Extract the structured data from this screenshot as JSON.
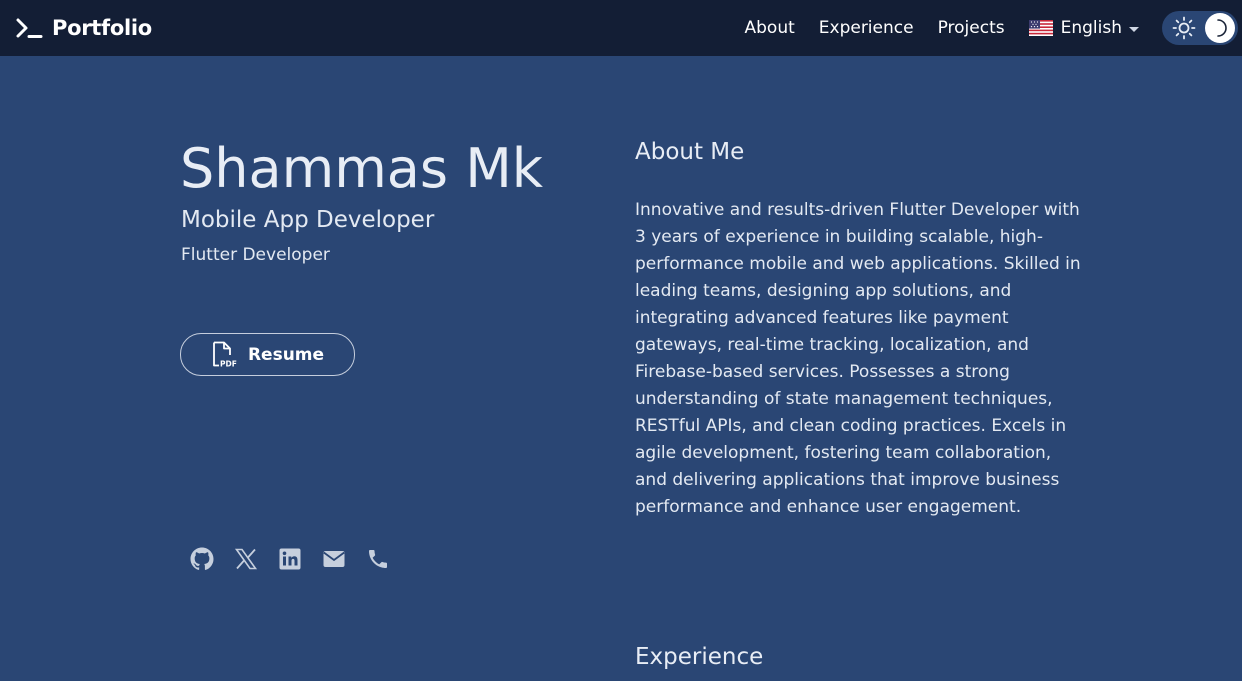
{
  "navbar": {
    "brand": {
      "icon": "terminal-icon",
      "label": "Portfolio"
    },
    "links": [
      {
        "label": "About"
      },
      {
        "label": "Experience"
      },
      {
        "label": "Projects"
      }
    ],
    "language": {
      "icon": "us-flag-icon",
      "label": "English"
    },
    "theme_toggle": {
      "icons": [
        "sun-icon",
        "moon-icon"
      ],
      "mode": "dark"
    }
  },
  "hero": {
    "name": "Shammas Mk",
    "role": "Mobile App Developer",
    "subtitle": "Flutter Developer",
    "resume_button": {
      "icon": "pdf-file-icon",
      "label": "Resume"
    },
    "socials": [
      "github-icon",
      "x-icon",
      "linkedin-icon",
      "mail-icon",
      "phone-icon"
    ]
  },
  "about": {
    "title": "About Me",
    "text": "Innovative and results-driven Flutter Developer with 3 years of experience in building scalable, high-performance mobile and web applications. Skilled in leading teams, designing app solutions, and integrating advanced features like payment gateways, real-time tracking, localization, and Firebase-based services. Possesses a strong understanding of state management techniques, RESTful APIs, and clean coding practices. Excels in agile development, fostering team collaboration, and delivering applications that improve business performance and enhance user engagement."
  },
  "experience": {
    "title": "Experience"
  },
  "colors": {
    "background": "#2a4674",
    "navbar": "#131e35",
    "text": "#e3e9f2",
    "icon": "#c6cfdd"
  }
}
